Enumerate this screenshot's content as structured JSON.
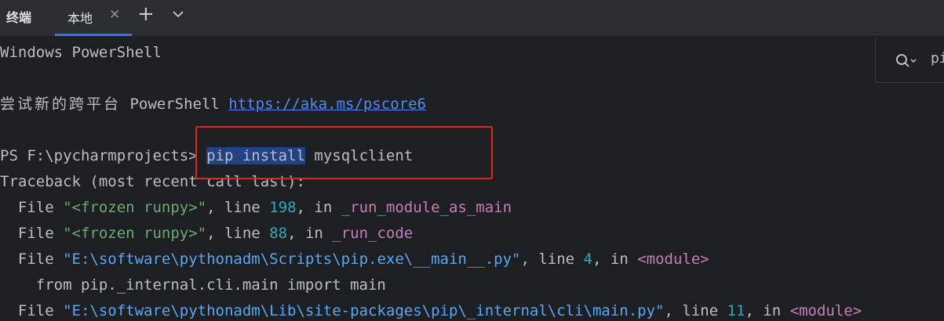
{
  "tabbar": {
    "panel_title": "终端",
    "tab_label": "本地",
    "close_symbol": "✕",
    "add_symbol": "+"
  },
  "search": {
    "value": "pi"
  },
  "terminal": {
    "line1": "Windows PowerShell",
    "line2_text": "尝试新的跨平台",
    "line2_brand": " PowerShell ",
    "line2_link": "https://aka.ms/pscore6",
    "prompt": "PS F:\\pycharmprojects> ",
    "cmd_selected": "pip install",
    "cmd_rest": " mysqlclient",
    "traceback": "Traceback (most recent call last):",
    "tb1_a": "  File ",
    "tb1_file": "\"<frozen runpy>\"",
    "tb1_b": ", line ",
    "tb1_line": "198",
    "tb1_c": ", in ",
    "tb1_fn": "_run_module_as_main",
    "tb2_a": "  File ",
    "tb2_file": "\"<frozen runpy>\"",
    "tb2_b": ", line ",
    "tb2_line": "88",
    "tb2_c": ", in ",
    "tb2_fn": "_run_code",
    "tb3_a": "  File ",
    "tb3_file": "\"E:\\software\\pythonadm\\Scripts\\pip.exe\\__main__.py\"",
    "tb3_b": ", line ",
    "tb3_line": "4",
    "tb3_c": ", in ",
    "tb3_fn": "<module>",
    "code_line": "    from pip._internal.cli.main import main",
    "tb4_a": "  File ",
    "tb4_file": "\"E:\\software\\pythonadm\\Lib\\site-packages\\pip\\_internal\\cli\\main.py\"",
    "tb4_b": ", line ",
    "tb4_line": "11",
    "tb4_c": ", in ",
    "tb4_fn": "<module>"
  },
  "colors": {
    "background": "#1e1f22",
    "tabbar": "#2b2d30",
    "accent": "#3574f0",
    "link": "#548af7",
    "selection": "#214283",
    "annotation_box": "#e0241b"
  }
}
